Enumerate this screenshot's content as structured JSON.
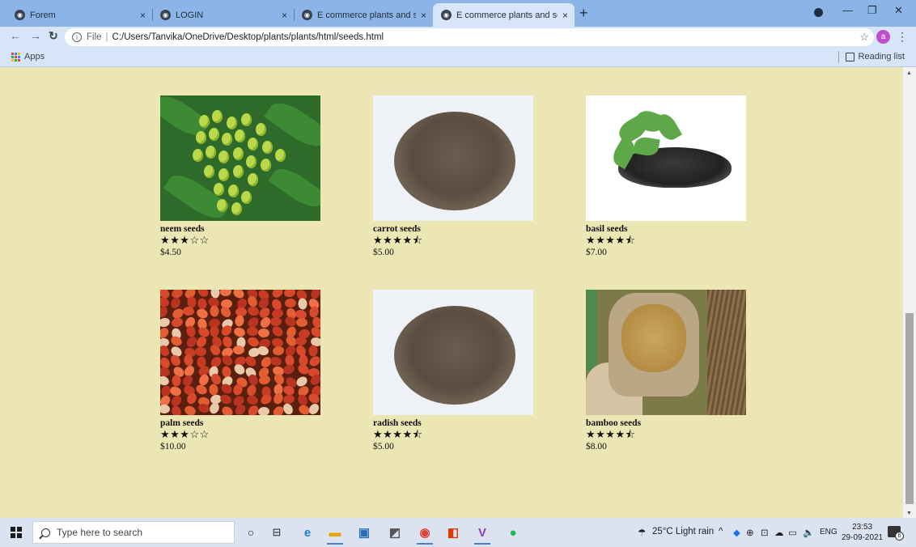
{
  "browser": {
    "tabs": [
      {
        "title": "Forem",
        "active": false
      },
      {
        "title": "LOGIN",
        "active": false
      },
      {
        "title": "E commerce plants and seeds pl",
        "active": false
      },
      {
        "title": "E commerce plants and seeds pl",
        "active": true
      }
    ],
    "tab_close": "×",
    "new_tab": "+",
    "address": {
      "prefix": "File",
      "url": "C:/Users/Tanvika/OneDrive/Desktop/plants/plants/html/seeds.html"
    },
    "profile_initial": "a",
    "bookmarks": {
      "apps_label": "Apps",
      "reading_list_label": "Reading list"
    }
  },
  "products": [
    {
      "name": "neem seeds",
      "stars": "★★★☆☆",
      "price": "$4.50",
      "rating": 3
    },
    {
      "name": "carrot seeds",
      "stars": "★★★★⯪",
      "price": "$5.00",
      "rating": 4.5
    },
    {
      "name": "basil seeds",
      "stars": "★★★★⯪",
      "price": "$7.00",
      "rating": 4.5
    },
    {
      "name": "palm seeds",
      "stars": "★★★☆☆",
      "price": "$10.00",
      "rating": 3
    },
    {
      "name": "radish seeds",
      "stars": "★★★★⯪",
      "price": "$5.00",
      "rating": 4.5
    },
    {
      "name": "bamboo seeds",
      "stars": "★★★★⯪",
      "price": "$8.00",
      "rating": 4.5
    }
  ],
  "taskbar": {
    "search_placeholder": "Type here to search",
    "weather": "25°C  Light rain",
    "language": "ENG",
    "time": "23:53",
    "date": "29-09-2021",
    "notification_count": "6"
  },
  "colors": {
    "page_background": "#ece6b4",
    "tabstrip": "#8cb4e6",
    "toolbar": "#d6e5f7"
  }
}
